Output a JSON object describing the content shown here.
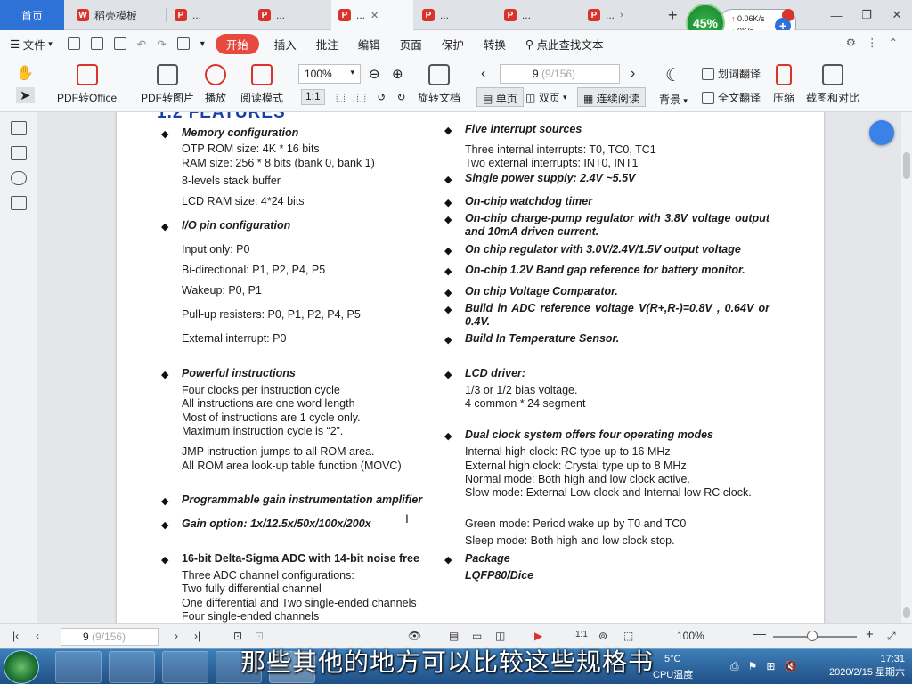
{
  "tabs": [
    {
      "label": "首页"
    },
    {
      "label": "稻壳模板"
    },
    {
      "label": "..."
    },
    {
      "label": "..."
    },
    {
      "label": "..."
    },
    {
      "label": "..."
    },
    {
      "label": "..."
    },
    {
      "label": "..."
    },
    {
      "label": "..."
    }
  ],
  "menu": {
    "file": "文件",
    "start": "开始",
    "insert": "插入",
    "annotate": "批注",
    "edit": "编辑",
    "page": "页面",
    "protect": "保护",
    "convert": "转换",
    "search": "点此查找文本"
  },
  "toolbar": {
    "pdf_to_office": "PDF转Office",
    "pdf_to_image": "PDF转图片",
    "play": "播放",
    "read_mode": "阅读模式",
    "zoom": "100%",
    "page_num": "9",
    "page_total": "(9/156)",
    "rotate": "旋转文档",
    "single": "单页",
    "double": "双页",
    "continuous": "连续阅读",
    "background": "背景",
    "word_translate": "划词翻译",
    "full_translate": "全文翻译",
    "compress": "压缩",
    "screenshot_compare": "截图和对比"
  },
  "document": {
    "heading": "1.2  FEATURES",
    "left": [
      {
        "text": "Memory configuration",
        "style": "bi",
        "bullet": true
      },
      {
        "text": "OTP ROM size: 4K * 16 bits"
      },
      {
        "text": "RAM size: 256 * 8 bits (bank 0, bank 1)"
      },
      {
        "text": "8-levels stack buffer"
      },
      {
        "text": "LCD RAM size: 4*24 bits"
      },
      {
        "text": "I/O pin configuration",
        "style": "bi",
        "bullet": true
      },
      {
        "text": "Input only: P0"
      },
      {
        "text": "Bi-directional: P1, P2, P4, P5"
      },
      {
        "text": "Wakeup: P0, P1"
      },
      {
        "text": "Pull-up resisters: P0, P1, P2, P4, P5"
      },
      {
        "text": "External interrupt: P0"
      },
      {
        "text": "Powerful instructions",
        "style": "bi",
        "bullet": true
      },
      {
        "text": "Four clocks per instruction cycle"
      },
      {
        "text": "All instructions are one word length"
      },
      {
        "text": "Most of instructions are 1 cycle only."
      },
      {
        "text": "Maximum instruction cycle is “2”."
      },
      {
        "text": "JMP instruction jumps to all ROM area."
      },
      {
        "text": "All ROM area look-up table function (MOVC)"
      },
      {
        "text": "Programmable gain instrumentation amplifier",
        "style": "bi",
        "bullet": true
      },
      {
        "text": "Gain option: 1x/12.5x/50x/100x/200x",
        "style": "bi",
        "bullet": true
      },
      {
        "text": "16-bit Delta-Sigma ADC with 14-bit noise free",
        "style": "b",
        "bullet": true
      },
      {
        "text": "Three ADC channel configurations:"
      },
      {
        "text": "Two fully differential channel"
      },
      {
        "text": "One differential and Two single-ended channels"
      },
      {
        "text": "Four single-ended channels"
      }
    ],
    "right": [
      {
        "text": "Five interrupt sources",
        "style": "bi",
        "bullet": true
      },
      {
        "text": "Three internal interrupts: T0, TC0, TC1"
      },
      {
        "text": "Two external interrupts: INT0, INT1"
      },
      {
        "text": "Single power supply: 2.4V ~5.5V",
        "style": "bi",
        "bullet": true
      },
      {
        "text": "On-chip watchdog timer",
        "style": "bi",
        "bullet": true
      },
      {
        "text": "On-chip charge-pump regulator with 3.8V voltage output and 10mA driven current.",
        "style": "bi",
        "bullet": true
      },
      {
        "text": "On chip regulator with 3.0V/2.4V/1.5V output voltage",
        "style": "bi",
        "bullet": true
      },
      {
        "text": "On-chip 1.2V Band gap reference for battery monitor.",
        "style": "bi",
        "bullet": true
      },
      {
        "text": "On chip Voltage Comparator.",
        "style": "bi",
        "bullet": true
      },
      {
        "text": "Build in ADC reference voltage V(R+,R-)=0.8V , 0.64V or 0.4V.",
        "style": "bi",
        "bullet": true
      },
      {
        "text": "Build In Temperature Sensor.",
        "style": "bi",
        "bullet": true
      },
      {
        "text": "LCD driver:",
        "style": "bi",
        "bullet": true
      },
      {
        "text": "1/3 or 1/2 bias voltage."
      },
      {
        "text": "4 common * 24 segment"
      },
      {
        "text": "Dual clock system offers four operating modes",
        "style": "bi",
        "bullet": true
      },
      {
        "text": "Internal high clock: RC type up to 16 MHz"
      },
      {
        "text": "External high clock: Crystal type up to 8 MHz"
      },
      {
        "text": "Normal mode: Both high and low clock active."
      },
      {
        "text": "Slow mode: External Low clock and Internal low RC clock."
      },
      {
        "text": "Green mode: Period wake up by T0 and TC0"
      },
      {
        "text": "Sleep mode: Both high and low clock stop."
      },
      {
        "text": "Package",
        "style": "bi",
        "bullet": true
      },
      {
        "text": "LQFP80/Dice",
        "style": "bi"
      }
    ]
  },
  "status": {
    "page_num": "9",
    "page_total": "(9/156)",
    "zoom": "100%"
  },
  "net": {
    "percent": "45%",
    "up": "0.06K/s",
    "down": "0K/s"
  },
  "taskbar": {
    "subtitle": "那些其他的地方可以比较这些规格书",
    "cpu_temp": "CPU温度",
    "temp": "5°C",
    "time": "17:31",
    "date": "2020/2/15 星期六"
  },
  "bullet_char": "◆"
}
